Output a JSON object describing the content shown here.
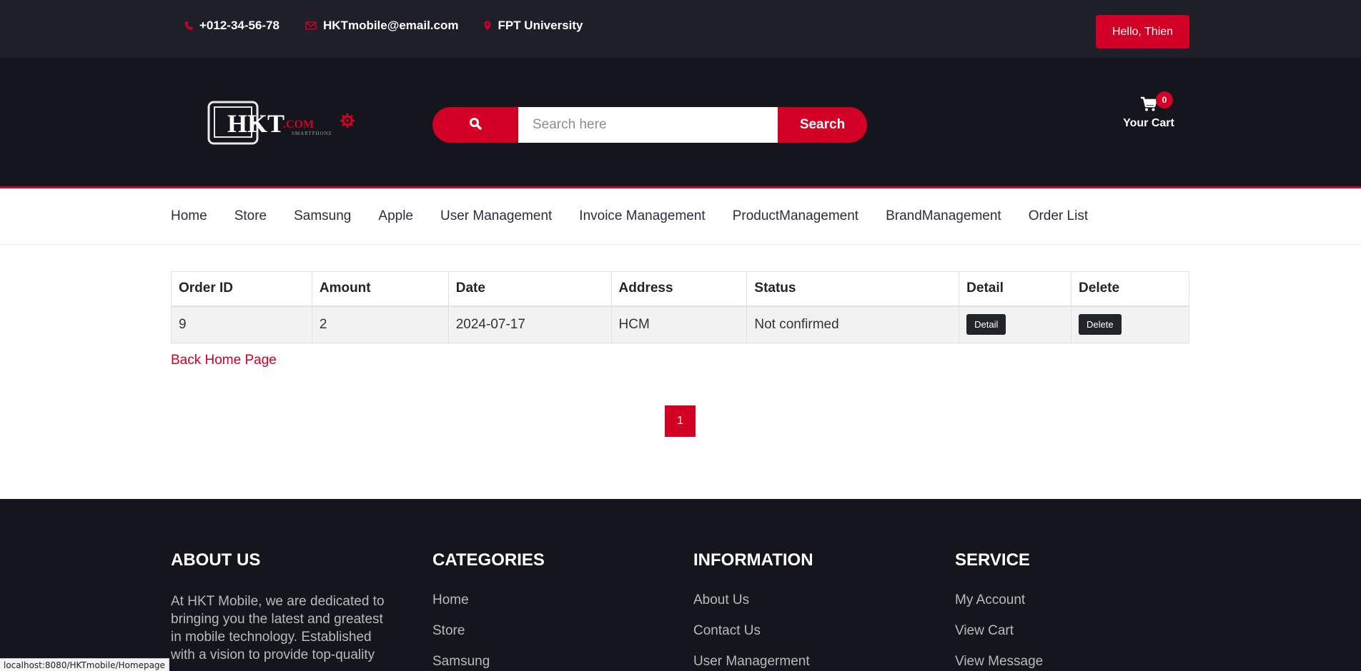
{
  "colors": {
    "accent": "#d10024",
    "top_bar_bg": "#1e1f29",
    "header_bg": "#15161d"
  },
  "top_bar": {
    "phone": "+012-34-56-78",
    "email": "HKTmobile@email.com",
    "location": "FPT University",
    "user_button": "Hello, Thien",
    "icons": [
      "phone-icon",
      "envelope-icon",
      "map-marker-icon"
    ]
  },
  "header": {
    "search": {
      "placeholder": "Search here",
      "button_label": "Search"
    },
    "cart": {
      "label": "Your Cart",
      "qty": "0"
    }
  },
  "nav": {
    "items": [
      "Home",
      "Store",
      "Samsung",
      "Apple",
      "User Management",
      "Invoice Management",
      "ProductManagement",
      "BrandManagement",
      "Order List"
    ]
  },
  "orders": {
    "headers": [
      "Order ID",
      "Amount",
      "Date",
      "Address",
      "Status",
      "Detail",
      "Delete"
    ],
    "rows": [
      {
        "id": "9",
        "amount": "2",
        "date": "2024-07-17",
        "address": "HCM",
        "status": "Not confirmed",
        "detail_label": "Detail",
        "delete_label": "Delete"
      }
    ]
  },
  "back_link": "Back Home Page",
  "pagination": {
    "current": "1"
  },
  "footer": {
    "about": {
      "title": "ABOUT US",
      "lines": [
        "At HKT Mobile, we are dedicated to",
        "bringing you the latest and greatest",
        "in mobile technology. Established",
        "with a vision to provide top-quality"
      ]
    },
    "categories": {
      "title": "CATEGORIES",
      "links": [
        "Home",
        "Store",
        "Samsung"
      ]
    },
    "information": {
      "title": "INFORMATION",
      "links": [
        "About Us",
        "Contact Us",
        "User Managerment"
      ]
    },
    "service": {
      "title": "SERVICE",
      "links": [
        "My Account",
        "View Cart",
        "View Message"
      ]
    }
  },
  "status_bar_url": "localhost:8080/HKTmobile/Homepage"
}
